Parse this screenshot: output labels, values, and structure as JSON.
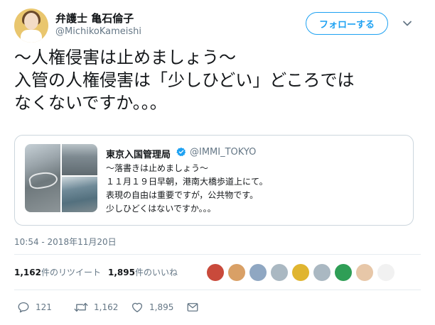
{
  "author": {
    "name": "弁護士 亀石倫子",
    "handle": "@MichikoKameishi",
    "follow_label": "フォローする"
  },
  "icons": {
    "more": "chevron-down-icon",
    "verified": "verified-badge-icon",
    "reply": "reply-icon",
    "retweet": "retweet-icon",
    "like": "heart-icon",
    "dm": "envelope-icon"
  },
  "tweet": {
    "lines": [
      "～人権侵害は止めましょう～",
      "入管の人権侵害は「少しひどい」どころでは",
      "なくないですか。。。"
    ]
  },
  "quote": {
    "name": "東京入国管理局",
    "handle": "@IMMI_TOKYO",
    "lines": [
      "～落書きは止めましょう～",
      "１１月１９日早朝，港南大橋歩道上にて。",
      "表現の自由は重要ですが，公共物です。",
      "少しひどくはないですか。。。"
    ]
  },
  "timestamp": "10:54 - 2018年11月20日",
  "stats": {
    "retweets_count": "1,162",
    "retweets_label": "件のリツイート",
    "likes_count": "1,895",
    "likes_label": "件のいいね"
  },
  "actions": {
    "reply_count": "121",
    "retweet_count": "1,162",
    "like_count": "1,895"
  },
  "colors": {
    "accent": "#1da1f2",
    "muted": "#657786",
    "border": "#e6ecf0"
  }
}
